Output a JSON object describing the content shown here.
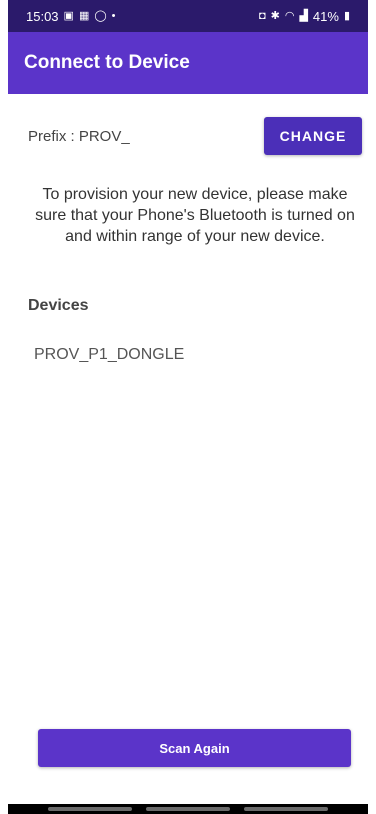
{
  "status_bar": {
    "time": "15:03",
    "battery": "41%",
    "icons_left": [
      "gallery-icon",
      "teams-icon",
      "whatsapp-icon",
      "dot-icon"
    ],
    "icons_right": [
      "alarm-icon",
      "bluetooth-icon",
      "wifi-icon",
      "signal-icon",
      "battery-icon"
    ]
  },
  "app_bar": {
    "title": "Connect to Device",
    "color": "#5b34c9"
  },
  "prefix": {
    "label": "Prefix : PROV_",
    "button_label": "CHANGE"
  },
  "info": {
    "text": "To provision your new device, please make sure that your Phone's Bluetooth is turned on and within range of your new device."
  },
  "devices": {
    "heading": "Devices",
    "items": [
      "PROV_P1_DONGLE"
    ]
  },
  "footer": {
    "scan_button_label": "Scan Again"
  }
}
